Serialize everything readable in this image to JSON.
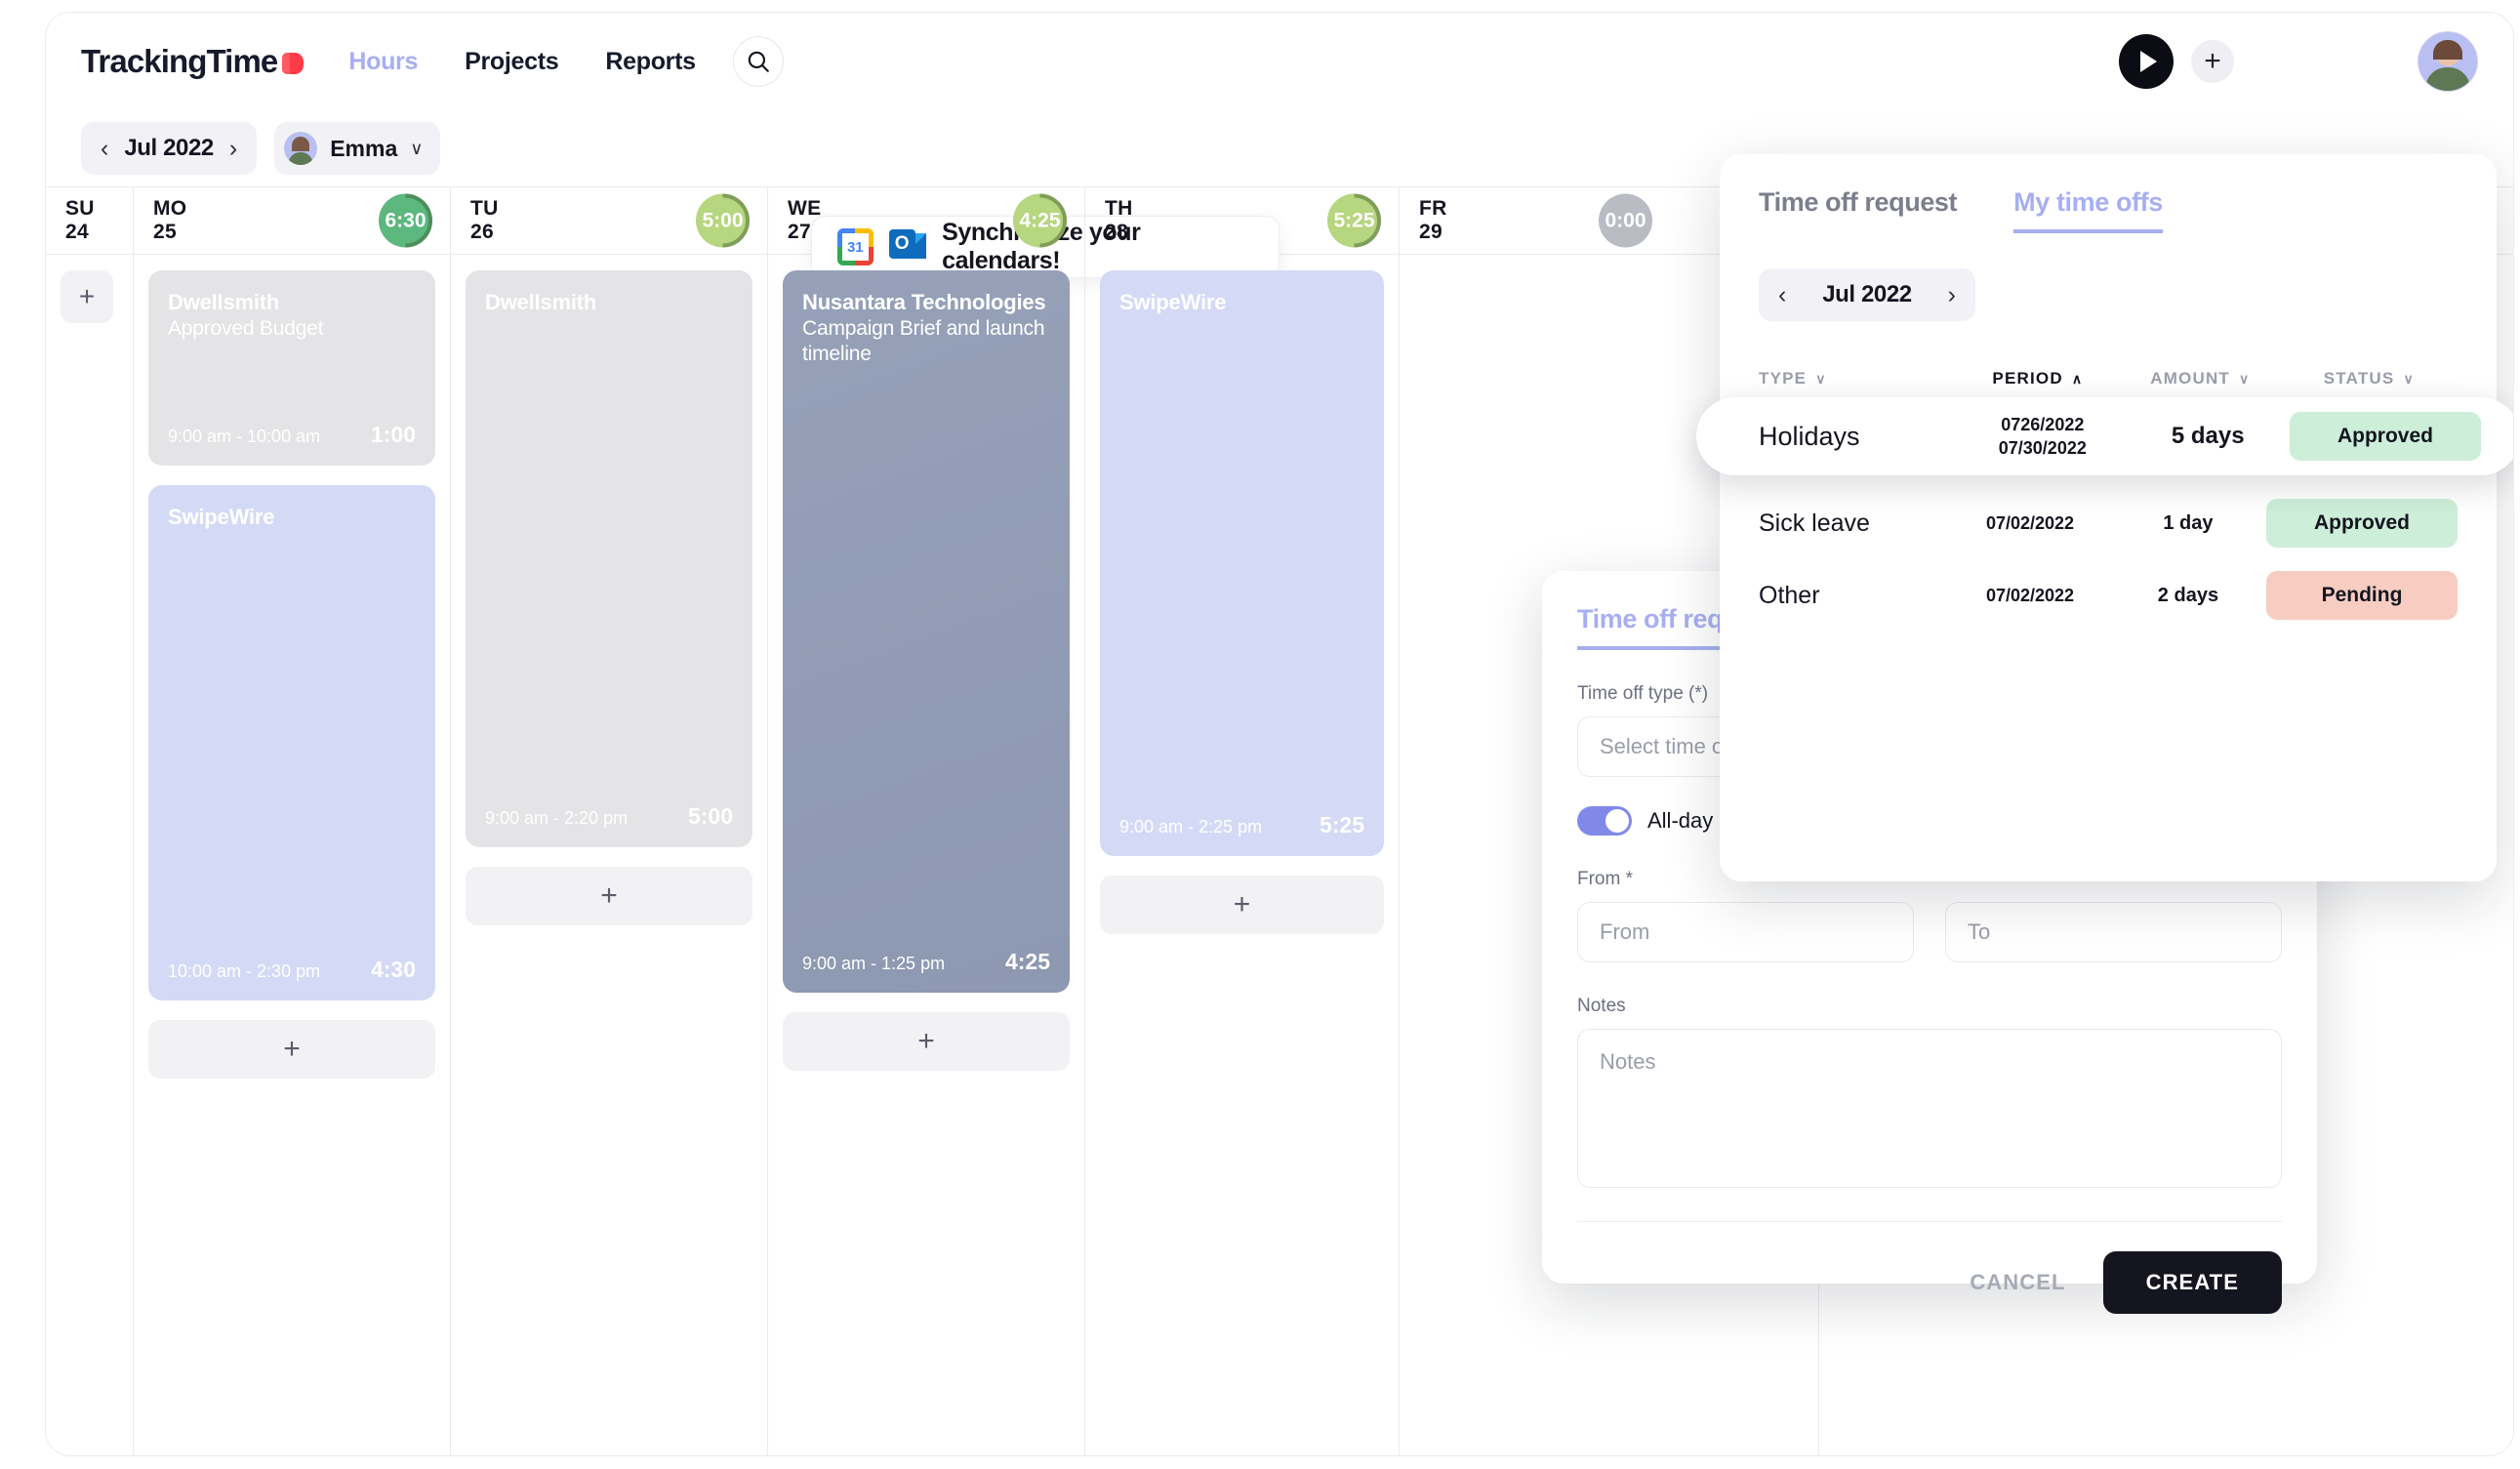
{
  "header": {
    "brand": "TrackingTime",
    "nav": [
      {
        "label": "Hours",
        "active": true
      },
      {
        "label": "Projects",
        "active": false
      },
      {
        "label": "Reports",
        "active": false
      }
    ],
    "search_icon": "search-icon",
    "play_icon": "play-icon",
    "add_icon": "plus-icon",
    "avatar": "user-avatar"
  },
  "toolbar": {
    "prev": "‹",
    "period": "Jul 2022",
    "next": "›",
    "user": "Emma",
    "user_chevron": "∨",
    "sync_banner": "Synchronize your calendars!",
    "gcal_day": "31",
    "outlook_letter": "O"
  },
  "calendar": {
    "days": [
      {
        "dow": "SU",
        "dom": "24",
        "total": "",
        "badge_color": ""
      },
      {
        "dow": "MO",
        "dom": "25",
        "total": "6:30",
        "badge_color": "#5cb87f"
      },
      {
        "dow": "TU",
        "dom": "26",
        "total": "5:00",
        "badge_color": "#b6d67f"
      },
      {
        "dow": "WE",
        "dom": "27",
        "total": "4:25",
        "badge_color": "#b6d67f"
      },
      {
        "dow": "TH",
        "dom": "28",
        "total": "5:25",
        "badge_color": "#b6d67f"
      },
      {
        "dow": "FR",
        "dom": "29",
        "total": "0:00",
        "badge_color": "#b9bcc3"
      }
    ],
    "add_slot_icon": "plus-icon",
    "entries": {
      "sunday": [],
      "monday": [
        {
          "project": "Dwellsmith",
          "task": "Approved Budget",
          "range": "9:00 am - 10:00 am",
          "duration": "1:00",
          "style": "grey"
        },
        {
          "project": "SwipeWire",
          "task": "",
          "range": "10:00 am - 2:30 pm",
          "duration": "4:30",
          "style": "lav"
        }
      ],
      "tuesday": [
        {
          "project": "Dwellsmith",
          "task": "",
          "range": "9:00 am - 2:20 pm",
          "duration": "5:00",
          "style": "grey"
        }
      ],
      "wednesday": [
        {
          "project": "Nusantara Technologies",
          "task": "Campaign Brief and launch timeline",
          "range": "9:00 am - 1:25 pm",
          "duration": "4:25",
          "style": "slate"
        }
      ],
      "thursday": [
        {
          "project": "SwipeWire",
          "task": "",
          "range": "9:00 am - 2:25 pm",
          "duration": "5:25",
          "style": "lav"
        }
      ]
    }
  },
  "dialog": {
    "title": "Time off request",
    "type_label": "Time off type (*)",
    "type_value": "Select time off type",
    "allday_label": "All-day",
    "from_label": "From *",
    "from_placeholder": "From",
    "to_placeholder": "To",
    "notes_label": "Notes",
    "notes_placeholder": "Notes",
    "cancel": "CANCEL",
    "create": "CREATE"
  },
  "panel": {
    "tabs": [
      {
        "label": "Time off request",
        "active": false
      },
      {
        "label": "My time offs",
        "active": true
      }
    ],
    "prev": "‹",
    "period": "Jul 2022",
    "next": "›",
    "columns": [
      {
        "label": "TYPE",
        "sort": "∨",
        "active": false
      },
      {
        "label": "PERIOD",
        "sort": "∧",
        "active": true
      },
      {
        "label": "AMOUNT",
        "sort": "∨",
        "active": false
      },
      {
        "label": "STATUS",
        "sort": "∨",
        "active": false
      }
    ],
    "rows": [
      {
        "type": "Holidays",
        "period_start": "0726/2022",
        "period_end": "07/30/2022",
        "amount": "5 days",
        "status": "Approved",
        "status_style": "approved",
        "highlighted": true
      },
      {
        "type": "Sick leave",
        "period_start": "07/02/2022",
        "period_end": "",
        "amount": "1 day",
        "status": "Approved",
        "status_style": "approved",
        "highlighted": false
      },
      {
        "type": "Other",
        "period_start": "07/02/2022",
        "period_end": "",
        "amount": "2 days",
        "status": "Pending",
        "status_style": "pending",
        "highlighted": false
      }
    ]
  },
  "colors": {
    "accent": "#a7aff0",
    "dark": "#14151f",
    "approved": "#cdeed8",
    "pending": "#f7cdc2"
  }
}
